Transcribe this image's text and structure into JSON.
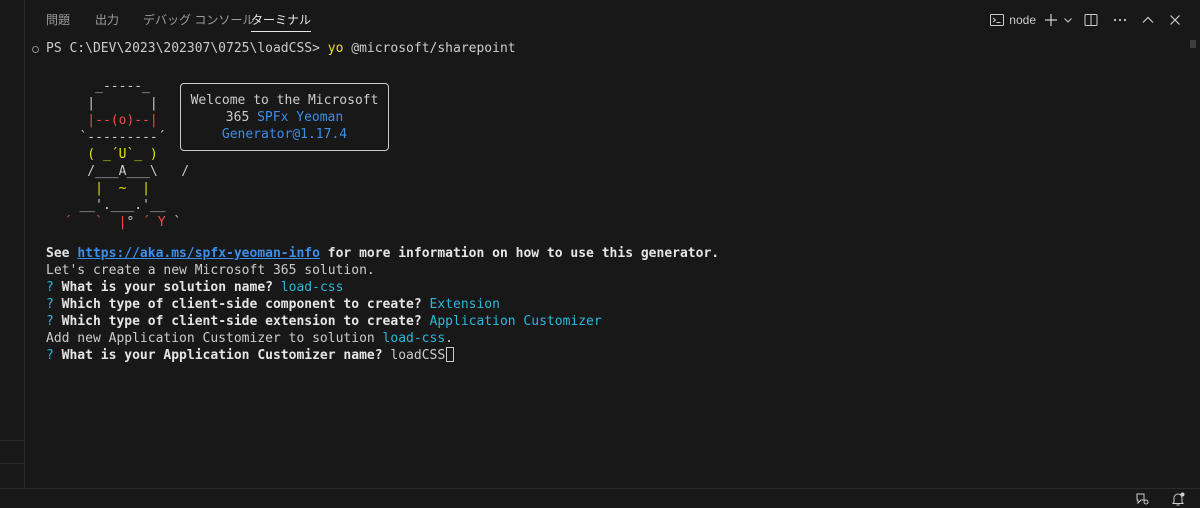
{
  "panel": {
    "tabs": [
      {
        "label": "問題"
      },
      {
        "label": "出力"
      },
      {
        "label": "デバッグ コンソール"
      },
      {
        "label": "ターミナル",
        "active": true
      }
    ],
    "actions": {
      "terminal_label": "node",
      "icons": [
        "terminal-icon",
        "plus-icon",
        "chevron-down-icon",
        "split-icon",
        "more-icon",
        "maximize-icon",
        "close-icon"
      ]
    }
  },
  "terminal": {
    "prompt": {
      "text": "PS C:\\DEV\\2023\\202307\\0725\\loadCSS> ",
      "command": "yo",
      "args": " @microsoft/sharepoint"
    },
    "ascii_art": {
      "l1": "     _-----_",
      "l2": "    |       |",
      "l3": "    |--(o)--|",
      "l4": "   `---------´",
      "l5a": "    ( ",
      "l5b": "_´U`_",
      "l5c": " )",
      "l6": "    /___A___\\   /",
      "l7": "     |  ~  |",
      "l8": "   __'.___.'__",
      "l9a": " ´   `  |",
      "l9b": "° ",
      "l9c": "´ Y",
      "l9d": " `"
    },
    "welcome": {
      "line1": "Welcome to the Microsoft",
      "line2_a": "365 ",
      "line2_b": "SPFx Yeoman",
      "line3": "Generator@1.17.4"
    },
    "info": {
      "see": "See ",
      "url": "https://aka.ms/spfx-yeoman-info",
      "rest": " for more information on how to use this generator."
    },
    "lines": {
      "create": "Let's create a new Microsoft 365 solution.",
      "q1_label": "What is your solution name?",
      "q1_value": "load-css",
      "q2_label": "Which type of client-side component to create?",
      "q2_value": "Extension",
      "q3_label": "Which type of client-side extension to create?",
      "q3_value": "Application Customizer",
      "add_text": "Add new Application Customizer to solution ",
      "add_value": "load-css",
      "add_end": ".",
      "q4_label": "What is your Application Customizer name?",
      "q4_value": "loadCSS",
      "q_mark": "?"
    }
  },
  "status_bar": {
    "icons": [
      "accounts-feedback-icon",
      "bell-icon"
    ]
  }
}
